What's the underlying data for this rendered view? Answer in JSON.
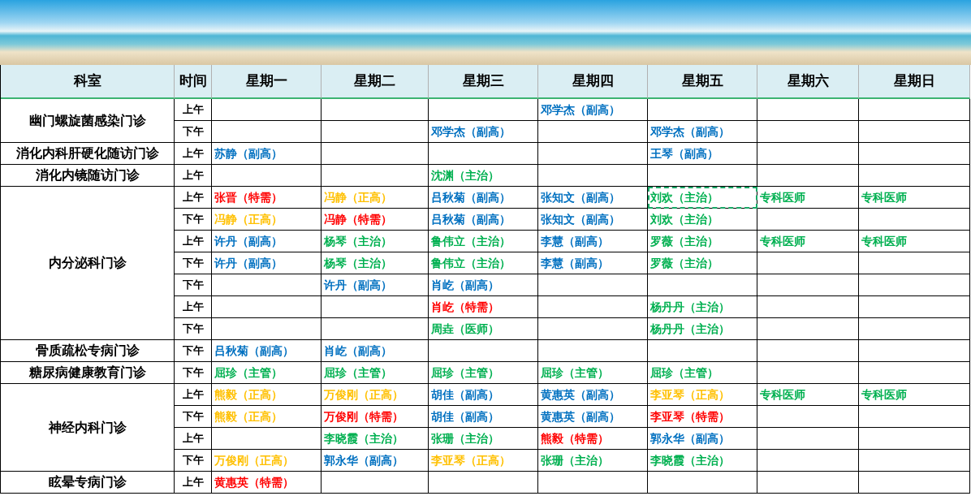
{
  "banner": {
    "kind": "beach-photo"
  },
  "table": {
    "columns": [
      "科室",
      "时间",
      "星期一",
      "星期二",
      "星期三",
      "星期四",
      "星期五",
      "星期六",
      "星期日"
    ],
    "groups": [
      {
        "department": "幽门螺旋菌感染门诊",
        "rows": [
          {
            "time": "上午",
            "cells": [
              null,
              null,
              null,
              {
                "text": "邓学杰（副高）",
                "color": "#0070c0",
                "selected": false
              },
              null,
              null,
              null
            ]
          },
          {
            "time": "下午",
            "cells": [
              null,
              null,
              {
                "text": "邓学杰（副高）",
                "color": "#0070c0",
                "selected": false
              },
              null,
              {
                "text": "邓学杰（副高）",
                "color": "#0070c0",
                "selected": false
              },
              null,
              null
            ]
          }
        ]
      },
      {
        "department": "消化内科肝硬化随访门诊",
        "rows": [
          {
            "time": "上午",
            "cells": [
              {
                "text": "苏静（副高）",
                "color": "#0070c0",
                "selected": false
              },
              null,
              null,
              null,
              {
                "text": "王琴（副高）",
                "color": "#0070c0",
                "selected": false
              },
              null,
              null
            ]
          }
        ]
      },
      {
        "department": "消化内镜随访门诊",
        "rows": [
          {
            "time": "上午",
            "cells": [
              null,
              null,
              {
                "text": "沈渊（主治）",
                "color": "#00b050",
                "selected": false
              },
              null,
              null,
              null,
              null
            ]
          }
        ]
      },
      {
        "department": "内分泌科门诊",
        "rows": [
          {
            "time": "上午",
            "cells": [
              {
                "text": "张晋（特需）",
                "color": "#ff0000",
                "selected": false
              },
              {
                "text": "冯静（正高）",
                "color": "#ffc000",
                "selected": false
              },
              {
                "text": "吕秋菊（副高）",
                "color": "#0070c0",
                "selected": false
              },
              {
                "text": "张知文（副高）",
                "color": "#0070c0",
                "selected": false
              },
              {
                "text": "刘欢（主治）",
                "color": "#00b050",
                "selected": true
              },
              {
                "text": "专科医师",
                "color": "#00b050",
                "selected": false
              },
              {
                "text": "专科医师",
                "color": "#00b050",
                "selected": false
              }
            ]
          },
          {
            "time": "下午",
            "cells": [
              {
                "text": "冯静（正高）",
                "color": "#ffc000",
                "selected": false
              },
              {
                "text": "冯静（特需）",
                "color": "#ff0000",
                "selected": false
              },
              {
                "text": "吕秋菊（副高）",
                "color": "#0070c0",
                "selected": false
              },
              {
                "text": "张知文（副高）",
                "color": "#0070c0",
                "selected": false
              },
              {
                "text": "刘欢（主治）",
                "color": "#00b050",
                "selected": false
              },
              null,
              null
            ]
          },
          {
            "time": "上午",
            "cells": [
              {
                "text": "许丹（副高）",
                "color": "#0070c0",
                "selected": false
              },
              {
                "text": "杨琴（主治）",
                "color": "#00b050",
                "selected": false
              },
              {
                "text": "鲁伟立（主治）",
                "color": "#00b050",
                "selected": false
              },
              {
                "text": "李慧（副高）",
                "color": "#0070c0",
                "selected": false
              },
              {
                "text": "罗薇（主治）",
                "color": "#00b050",
                "selected": false
              },
              {
                "text": "专科医师",
                "color": "#00b050",
                "selected": false
              },
              {
                "text": "专科医师",
                "color": "#00b050",
                "selected": false
              }
            ]
          },
          {
            "time": "下午",
            "cells": [
              {
                "text": "许丹（副高）",
                "color": "#0070c0",
                "selected": false
              },
              {
                "text": "杨琴（主治）",
                "color": "#00b050",
                "selected": false
              },
              {
                "text": "鲁伟立（主治）",
                "color": "#00b050",
                "selected": false
              },
              {
                "text": "李慧（副高）",
                "color": "#0070c0",
                "selected": false
              },
              {
                "text": "罗薇（主治）",
                "color": "#00b050",
                "selected": false
              },
              null,
              null
            ]
          },
          {
            "time": "下午",
            "cells": [
              null,
              {
                "text": "许丹（副高）",
                "color": "#0070c0",
                "selected": false
              },
              {
                "text": "肖屹（副高）",
                "color": "#0070c0",
                "selected": false
              },
              null,
              null,
              null,
              null
            ]
          },
          {
            "time": "上午",
            "cells": [
              null,
              null,
              {
                "text": "肖屹（特需）",
                "color": "#ff0000",
                "selected": false
              },
              null,
              {
                "text": "杨丹丹（主治）",
                "color": "#00b050",
                "selected": false
              },
              null,
              null
            ]
          },
          {
            "time": "下午",
            "cells": [
              null,
              null,
              {
                "text": "周垚（医师）",
                "color": "#00b050",
                "selected": false
              },
              null,
              {
                "text": "杨丹丹（主治）",
                "color": "#00b050",
                "selected": false
              },
              null,
              null
            ]
          }
        ]
      },
      {
        "department": "骨质疏松专病门诊",
        "rows": [
          {
            "time": "下午",
            "cells": [
              {
                "text": "吕秋菊（副高）",
                "color": "#0070c0",
                "selected": false
              },
              {
                "text": "肖屹（副高）",
                "color": "#0070c0",
                "selected": false
              },
              null,
              null,
              null,
              null,
              null
            ]
          }
        ]
      },
      {
        "department": "糖尿病健康教育门诊",
        "rows": [
          {
            "time": "下午",
            "cells": [
              {
                "text": "屈珍（主管）",
                "color": "#00b050",
                "selected": false
              },
              {
                "text": "屈珍（主管）",
                "color": "#00b050",
                "selected": false
              },
              {
                "text": "屈珍（主管）",
                "color": "#00b050",
                "selected": false
              },
              {
                "text": "屈珍（主管）",
                "color": "#00b050",
                "selected": false
              },
              {
                "text": "屈珍（主管）",
                "color": "#00b050",
                "selected": false
              },
              null,
              null
            ]
          }
        ]
      },
      {
        "department": "神经内科门诊",
        "rows": [
          {
            "time": "上午",
            "cells": [
              {
                "text": "熊毅（正高）",
                "color": "#ffc000",
                "selected": false
              },
              {
                "text": "万俊刚（正高）",
                "color": "#ffc000",
                "selected": false
              },
              {
                "text": "胡佳（副高）",
                "color": "#0070c0",
                "selected": false
              },
              {
                "text": "黄惠英（副高）",
                "color": "#0070c0",
                "selected": false
              },
              {
                "text": "李亚琴（正高）",
                "color": "#ffc000",
                "selected": false
              },
              {
                "text": "专科医师",
                "color": "#00b050",
                "selected": false
              },
              {
                "text": "专科医师",
                "color": "#00b050",
                "selected": false
              }
            ]
          },
          {
            "time": "下午",
            "cells": [
              {
                "text": "熊毅（正高）",
                "color": "#ffc000",
                "selected": false
              },
              {
                "text": "万俊刚（特需）",
                "color": "#ff0000",
                "selected": false
              },
              {
                "text": "胡佳（副高）",
                "color": "#0070c0",
                "selected": false
              },
              {
                "text": "黄惠英（副高）",
                "color": "#0070c0",
                "selected": false
              },
              {
                "text": "李亚琴（特需）",
                "color": "#ff0000",
                "selected": false
              },
              null,
              null
            ]
          },
          {
            "time": "上午",
            "cells": [
              null,
              {
                "text": "李晓霞（主治）",
                "color": "#00b050",
                "selected": false
              },
              {
                "text": "张珊（主治）",
                "color": "#00b050",
                "selected": false
              },
              {
                "text": "熊毅（特需）",
                "color": "#ff0000",
                "selected": false
              },
              {
                "text": "郭永华（副高）",
                "color": "#0070c0",
                "selected": false
              },
              null,
              null
            ]
          },
          {
            "time": "下午",
            "cells": [
              {
                "text": "万俊刚（正高）",
                "color": "#ffc000",
                "selected": false
              },
              {
                "text": "郭永华（副高）",
                "color": "#0070c0",
                "selected": false
              },
              {
                "text": "李亚琴（正高）",
                "color": "#ffc000",
                "selected": false
              },
              {
                "text": "张珊（主治）",
                "color": "#00b050",
                "selected": false
              },
              {
                "text": "李晓霞（主治）",
                "color": "#00b050",
                "selected": false
              },
              null,
              null
            ]
          }
        ]
      },
      {
        "department": "眩晕专病门诊",
        "rows": [
          {
            "time": "上午",
            "cells": [
              {
                "text": "黄惠英（特需）",
                "color": "#ff0000",
                "selected": false
              },
              null,
              null,
              null,
              null,
              null,
              null
            ]
          }
        ]
      }
    ]
  }
}
